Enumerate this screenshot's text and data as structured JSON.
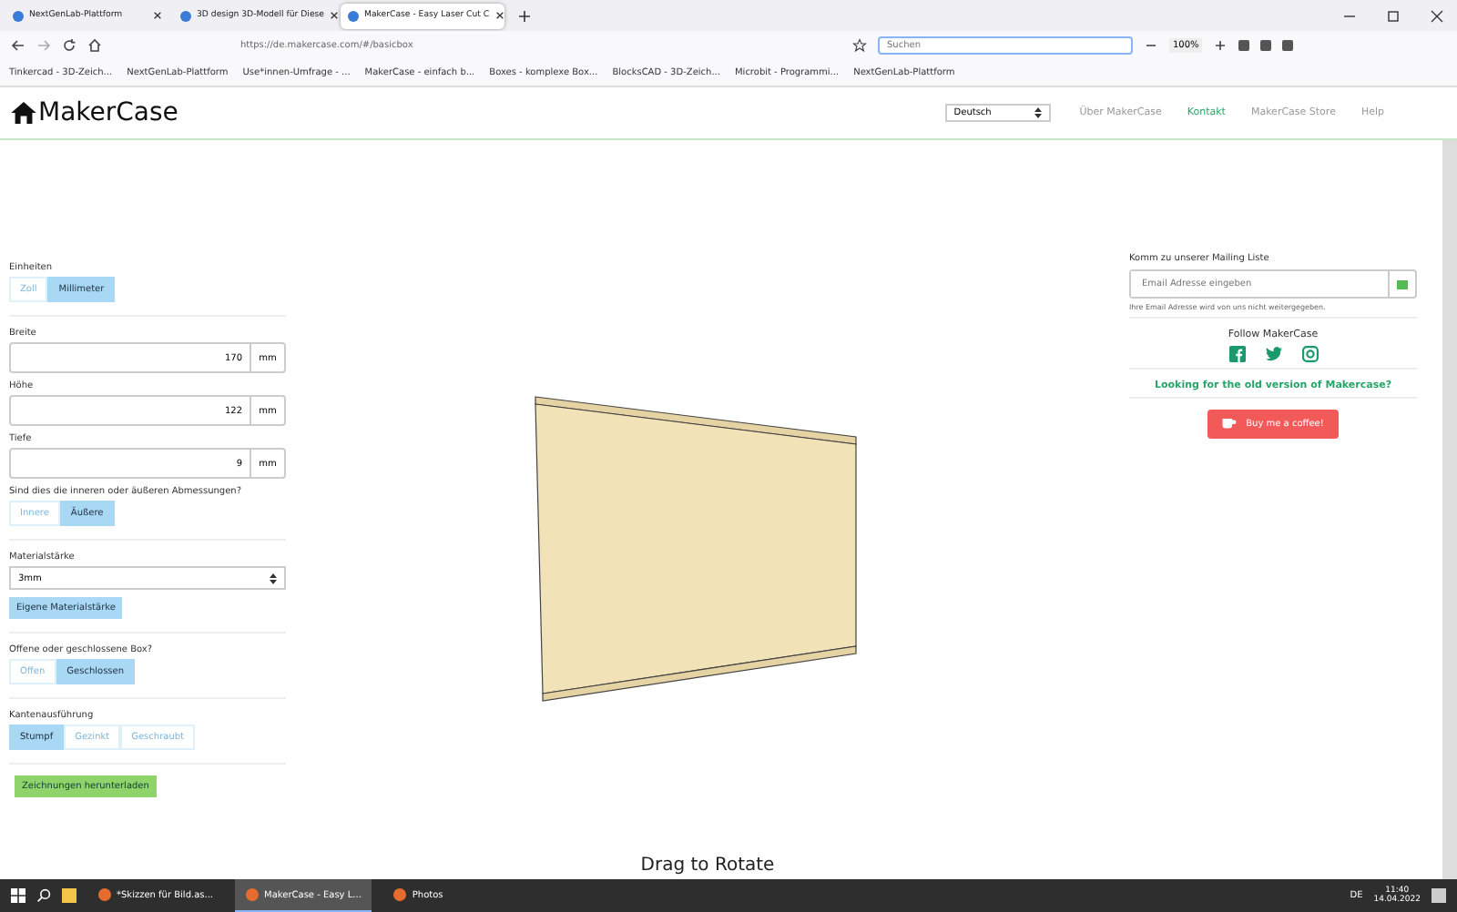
{
  "browser": {
    "tabs": [
      {
        "title": "NextGenLab-Plattform",
        "selected": false
      },
      {
        "title": "3D design 3D-Modell für Diese",
        "selected": false
      },
      {
        "title": "MakerCase - Easy Laser Cut C",
        "selected": true
      }
    ],
    "url": "https://de.makercase.com/#/basicbox",
    "search": {
      "placeholder": "Suchen"
    },
    "zoom": "100%",
    "bookmarks": [
      "Tinkercad - 3D-Zeich...",
      "NextGenLab-Plattform",
      "Use*innen-Umfrage - ...",
      "MakerCase - einfach b...",
      "Boxes - komplexe Box...",
      "BlocksCAD - 3D-Zeich...",
      "Microbit - Programmi...",
      "NextGenLab-Plattform"
    ]
  },
  "header": {
    "logo": "MakerCase",
    "language": "Deutsch",
    "nav": [
      {
        "label": "Über MakerCase",
        "selected": false
      },
      {
        "label": "Kontakt",
        "selected": true
      },
      {
        "label": "MakerCase Store",
        "selected": false
      },
      {
        "label": "Help",
        "selected": false
      }
    ]
  },
  "form": [
    {
      "kind": "toggle",
      "label": "Einheiten",
      "options": [
        {
          "label": "Zoll",
          "selected": false
        },
        {
          "label": "Millimeter",
          "selected": true
        }
      ]
    },
    {
      "kind": "number",
      "label": "Breite",
      "value": "170",
      "unit": "mm"
    },
    {
      "kind": "number",
      "label": "Höhe",
      "value": "122",
      "unit": "mm"
    },
    {
      "kind": "number",
      "label": "Tiefe",
      "value": "9",
      "unit": "mm"
    },
    {
      "kind": "toggle",
      "label": "Sind dies die inneren oder äußeren Abmessungen?",
      "options": [
        {
          "label": "Innere",
          "selected": false
        },
        {
          "label": "Äußere",
          "selected": true
        }
      ]
    },
    {
      "kind": "select",
      "label": "Materialstärke",
      "value": "3mm"
    },
    {
      "kind": "button",
      "label": "Eigene Materialstärke"
    },
    {
      "kind": "toggle",
      "label": "Offene oder geschlossene Box?",
      "options": [
        {
          "label": "Offen",
          "selected": false
        },
        {
          "label": "Geschlossen",
          "selected": true
        }
      ]
    },
    {
      "kind": "toggle",
      "label": "Kantenausführung",
      "options": [
        {
          "label": "Stumpf",
          "selected": true
        },
        {
          "label": "Gezinkt",
          "selected": false
        },
        {
          "label": "Geschraubt",
          "selected": false
        }
      ]
    },
    {
      "kind": "download",
      "label": "Zeichnungen herunterladen"
    }
  ],
  "caption": "Drag to Rotate",
  "sidebar": {
    "mailing_label": "Komm zu unserer Mailing Liste",
    "email": {
      "placeholder": "Email Adresse eingeben"
    },
    "note": "Ihre Email Adresse wird von uns nicht weitergegeben.",
    "follow": "Follow MakerCase",
    "old_version_link": "Looking for the old version of Makercase?",
    "coffee_button": "Buy me a coffee!"
  },
  "taskbar": {
    "items": [
      {
        "label": "*Skizzen für Bild.as...",
        "selected": false
      },
      {
        "label": "MakerCase - Easy L...",
        "selected": true
      },
      {
        "label": "Photos",
        "selected": false
      }
    ],
    "language": "DE",
    "time": "11:40",
    "date": "14.04.2022"
  }
}
